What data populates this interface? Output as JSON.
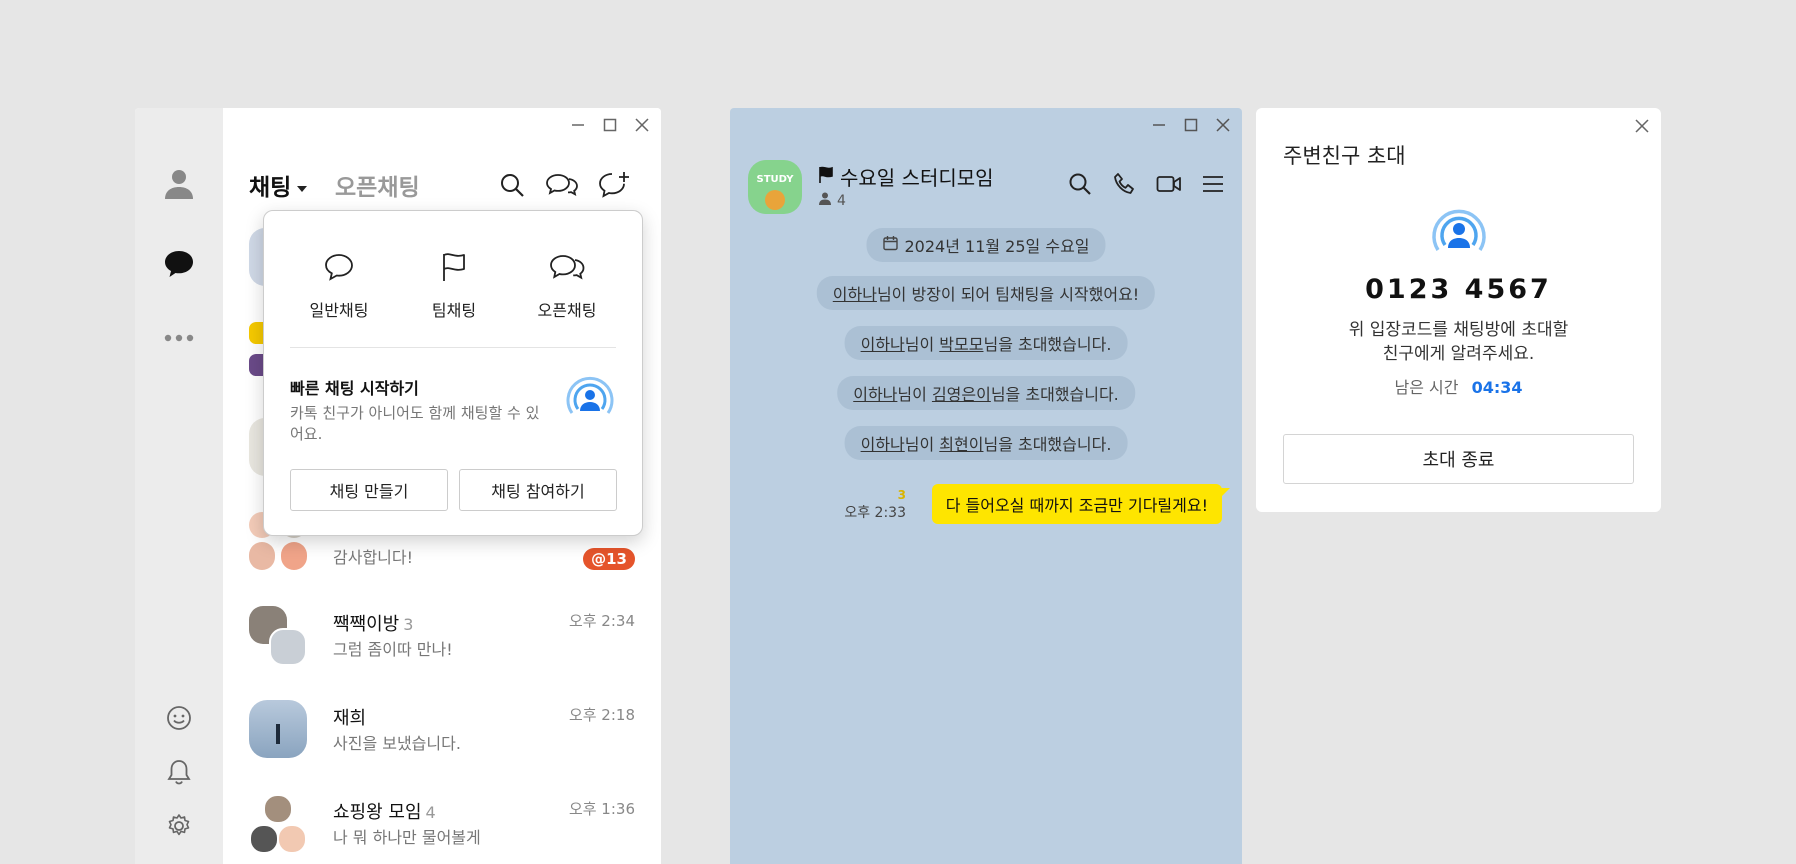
{
  "list_window": {
    "tabs": {
      "chat": "채팅",
      "open_chat": "오픈채팅"
    },
    "popup": {
      "options": [
        "일반채팅",
        "팀채팅",
        "오픈채팅"
      ],
      "quick_title": "빠른 채팅 시작하기",
      "quick_desc": "카톡 친구가 아니어도 함께 채팅할 수 있어요.",
      "create_button": "채팅 만들기",
      "join_button": "채팅 참여하기"
    },
    "chats": [
      {
        "preview": "감사합니다!",
        "badge": "@13"
      },
      {
        "name": "짹짹이방",
        "count": "3",
        "time": "오후 2:34",
        "preview": "그럼 좀이따 만나!"
      },
      {
        "name": "재희",
        "time": "오후 2:18",
        "preview": "사진을 보냈습니다."
      },
      {
        "name": "쇼핑왕 모임",
        "count": "4",
        "time": "오후 1:36",
        "preview": "나 뭐 하나만 물어볼게"
      }
    ]
  },
  "chat_window": {
    "room_avatar_text": "STUDY",
    "room_title": "수요일 스터디모임",
    "member_count": "4",
    "date_chip": "2024년 11월 25일 수요일",
    "system_messages": [
      {
        "name1": "이하나",
        "text": "님이 방장이 되어 팀채팅을 시작했어요!"
      },
      {
        "name1": "이하나",
        "mid": "님이 ",
        "name2": "박모모",
        "text": "님을 초대했습니다."
      },
      {
        "name1": "이하나",
        "mid": "님이 ",
        "name2": "김영은이",
        "text": "님을 초대했습니다."
      },
      {
        "name1": "이하나",
        "mid": "님이 ",
        "name2": "최현이",
        "text": "님을 초대했습니다."
      }
    ],
    "my_message": {
      "unread": "3",
      "time": "오후 2:33",
      "text": "다 들어오실 때까지 조금만 기다릴게요!"
    }
  },
  "invite_window": {
    "title": "주변친구 초대",
    "code": "0123 4567",
    "desc_line1": "위 입장코드를 채팅방에 초대할",
    "desc_line2": "친구에게 알려주세요.",
    "remaining_label": "남은 시간",
    "remaining_value": "04:34",
    "end_button": "초대 종료"
  },
  "colors": {
    "chat_bg": "#bccfe1",
    "bubble": "#fee500",
    "accent_blue": "#1a73e8",
    "badge": "#e5542b"
  },
  "icons": [
    "person-icon",
    "chat-bubble-icon",
    "more-icon",
    "emoji-icon",
    "bell-icon",
    "gear-icon",
    "search-icon",
    "open-chat-icon",
    "new-chat-icon",
    "flag-icon",
    "phone-icon",
    "video-icon",
    "menu-icon",
    "calendar-icon",
    "broadcast-icon",
    "close-icon"
  ]
}
